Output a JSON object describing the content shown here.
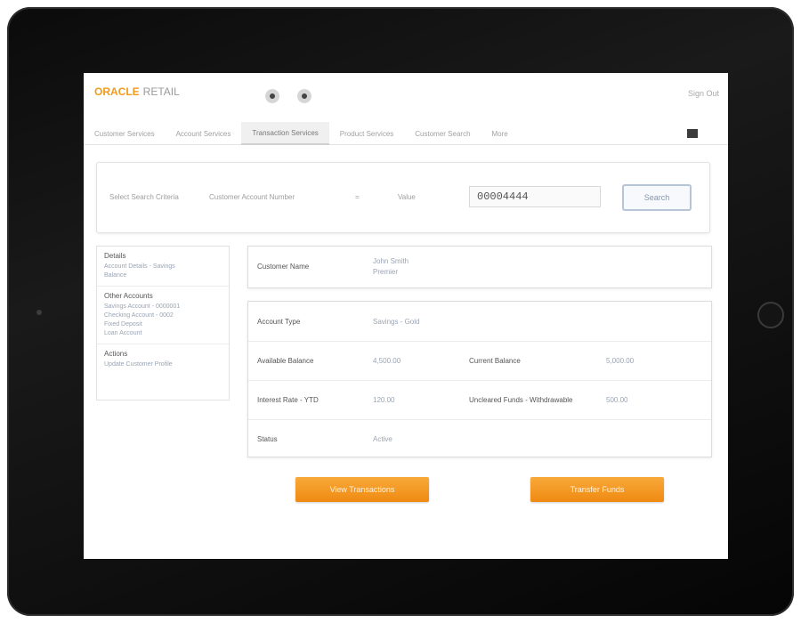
{
  "header": {
    "brand": "ORACLE",
    "product": "RETAIL",
    "signout": "Sign Out"
  },
  "nav": {
    "items": [
      "Customer Services",
      "Account Services",
      "Transaction Services",
      "Product Services",
      "Customer Search",
      "More"
    ]
  },
  "search": {
    "label_1": "Select Search Criteria",
    "label_2": "Customer Account Number",
    "separator": "=",
    "label_3": "Value",
    "value": "00004444",
    "button_label": "Search"
  },
  "sidebar": {
    "groups": [
      {
        "title": "Details",
        "links": [
          "Account Details - Savings",
          "Balance"
        ]
      },
      {
        "title": "Other Accounts",
        "links": [
          "Savings Account - 0000001",
          "Checking Account - 0002",
          "Fixed Deposit",
          "Loan Account"
        ]
      },
      {
        "title": "Actions",
        "links": [
          "Update Customer Profile"
        ]
      }
    ]
  },
  "details": {
    "customer_label": "Customer Name",
    "customer_value_line1": "John Smith",
    "customer_value_line2": "Premier",
    "account_type_label": "Account Type",
    "account_type_value": "Savings - Gold",
    "available_balance_label": "Available Balance",
    "available_balance_value": "4,500.00",
    "current_balance_label": "Current Balance",
    "current_balance_value": "5,000.00",
    "interest_ytd_label": "Interest Rate - YTD",
    "interest_ytd_value": "120.00",
    "uncleared_label": "Uncleared Funds - Withdrawable",
    "uncleared_value": "500.00",
    "status_label": "Status",
    "status_value": "Active"
  },
  "actions": {
    "button_1": "View Transactions",
    "button_2": "Transfer Funds"
  },
  "colors": {
    "accent": "#ef8a12",
    "link": "#9aa4b4"
  }
}
